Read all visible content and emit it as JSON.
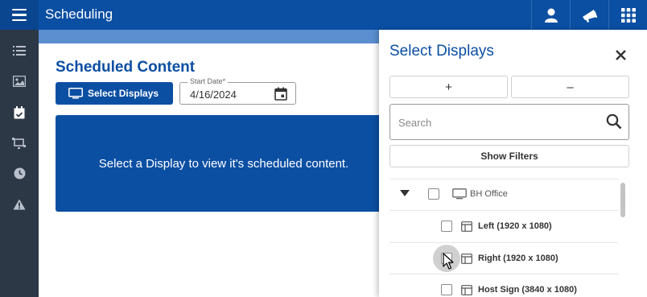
{
  "app": {
    "title": "Scheduling"
  },
  "topbar": {
    "icons": [
      "user-icon",
      "megaphone-icon",
      "apps-grid-icon"
    ]
  },
  "sidebar": {
    "items": [
      "list-icon",
      "image-icon",
      "calendar-check-icon",
      "display-layout-icon",
      "clock-icon",
      "warning-icon"
    ]
  },
  "main": {
    "title": "Scheduled Content",
    "select_displays_label": "Select Displays",
    "start_date_label": "Start Date*",
    "start_date_value": "4/16/2024",
    "info_message": "Select a Display to view it's scheduled content."
  },
  "panel": {
    "title": "Select Displays",
    "add_label": "+",
    "remove_label": "–",
    "search_placeholder": "Search",
    "show_filters_label": "Show Filters",
    "tree": {
      "parent": {
        "label": "BH Office",
        "expanded": true,
        "checked": false
      },
      "children": [
        {
          "label": "Left (1920 x 1080)",
          "checked": false
        },
        {
          "label": "Right (1920 x 1080)",
          "checked": false,
          "hovered": true
        },
        {
          "label": "Host Sign (3840 x 1080)",
          "checked": false
        }
      ]
    }
  },
  "colors": {
    "brand": "#0b4fa3",
    "sidebar": "#2d3846",
    "accent_strip": "#5b8fd0"
  }
}
